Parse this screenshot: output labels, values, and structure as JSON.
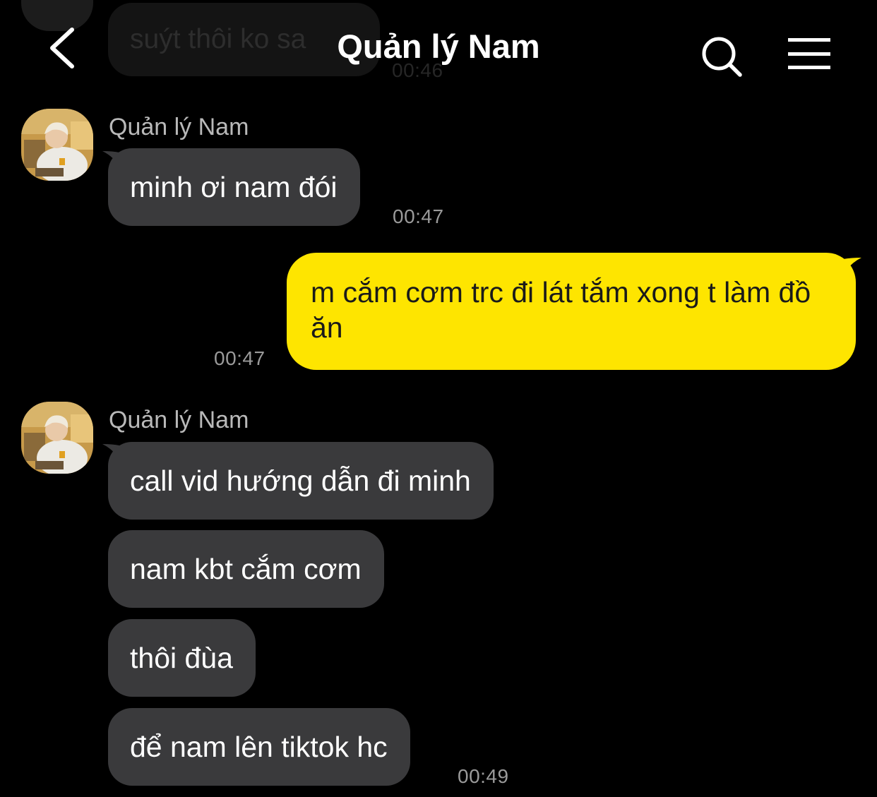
{
  "header": {
    "title": "Quản lý Nam",
    "back_icon": "chevron-left-icon",
    "search_icon": "search-icon",
    "menu_icon": "hamburger-menu-icon"
  },
  "previous_message": {
    "text": "suýt thôi ko sa",
    "time": "00:46"
  },
  "colors": {
    "background": "#000000",
    "incoming_bubble": "#3a3a3c",
    "outgoing_bubble": "#fee500",
    "timestamp": "#9a9a9a"
  },
  "groups": [
    {
      "sender": "Quản lý Nam",
      "messages": [
        {
          "text": "minh ơi nam đói",
          "time": "00:47"
        }
      ]
    },
    {
      "outgoing": true,
      "messages": [
        {
          "text": "m cắm cơm trc đi lát tắm xong t làm đồ ăn",
          "time": "00:47"
        }
      ]
    },
    {
      "sender": "Quản lý Nam",
      "messages": [
        {
          "text": "call vid hướng dẫn đi minh"
        },
        {
          "text": "nam kbt cắm cơm"
        },
        {
          "text": "thôi đùa"
        },
        {
          "text": "để nam lên tiktok hc",
          "time": "00:49"
        }
      ]
    }
  ]
}
